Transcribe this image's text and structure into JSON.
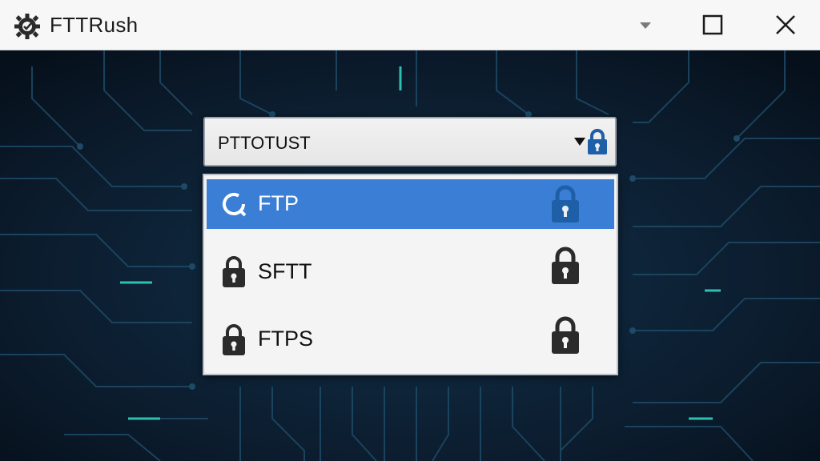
{
  "window": {
    "title": "FTTRush",
    "app_icon": "gear-icon",
    "controls": {
      "dropdown_icon": "chevron-down-icon",
      "maximize_icon": "maximize-icon",
      "close_icon": "close-icon"
    }
  },
  "combo": {
    "value": "PTTOTUST",
    "arrow_icon": "caret-down-icon",
    "lock_icon": "lock-icon"
  },
  "options": [
    {
      "label": "FTP",
      "selected": true,
      "leading_icon": "refresh-icon",
      "trailing_icon": "lock-icon"
    },
    {
      "label": "SFTT",
      "selected": false,
      "leading_icon": "lock-icon",
      "trailing_icon": "lock-icon"
    },
    {
      "label": "FTPS",
      "selected": false,
      "leading_icon": "lock-icon",
      "trailing_icon": "lock-icon"
    }
  ],
  "colors": {
    "selection": "#3a7fd5",
    "lock_blue": "#1f5fa8",
    "lock_dark": "#2b2b2b",
    "background": "#0b1b2c",
    "circuit": "#1e4a66",
    "circuit_glow": "#2fd3c0"
  }
}
